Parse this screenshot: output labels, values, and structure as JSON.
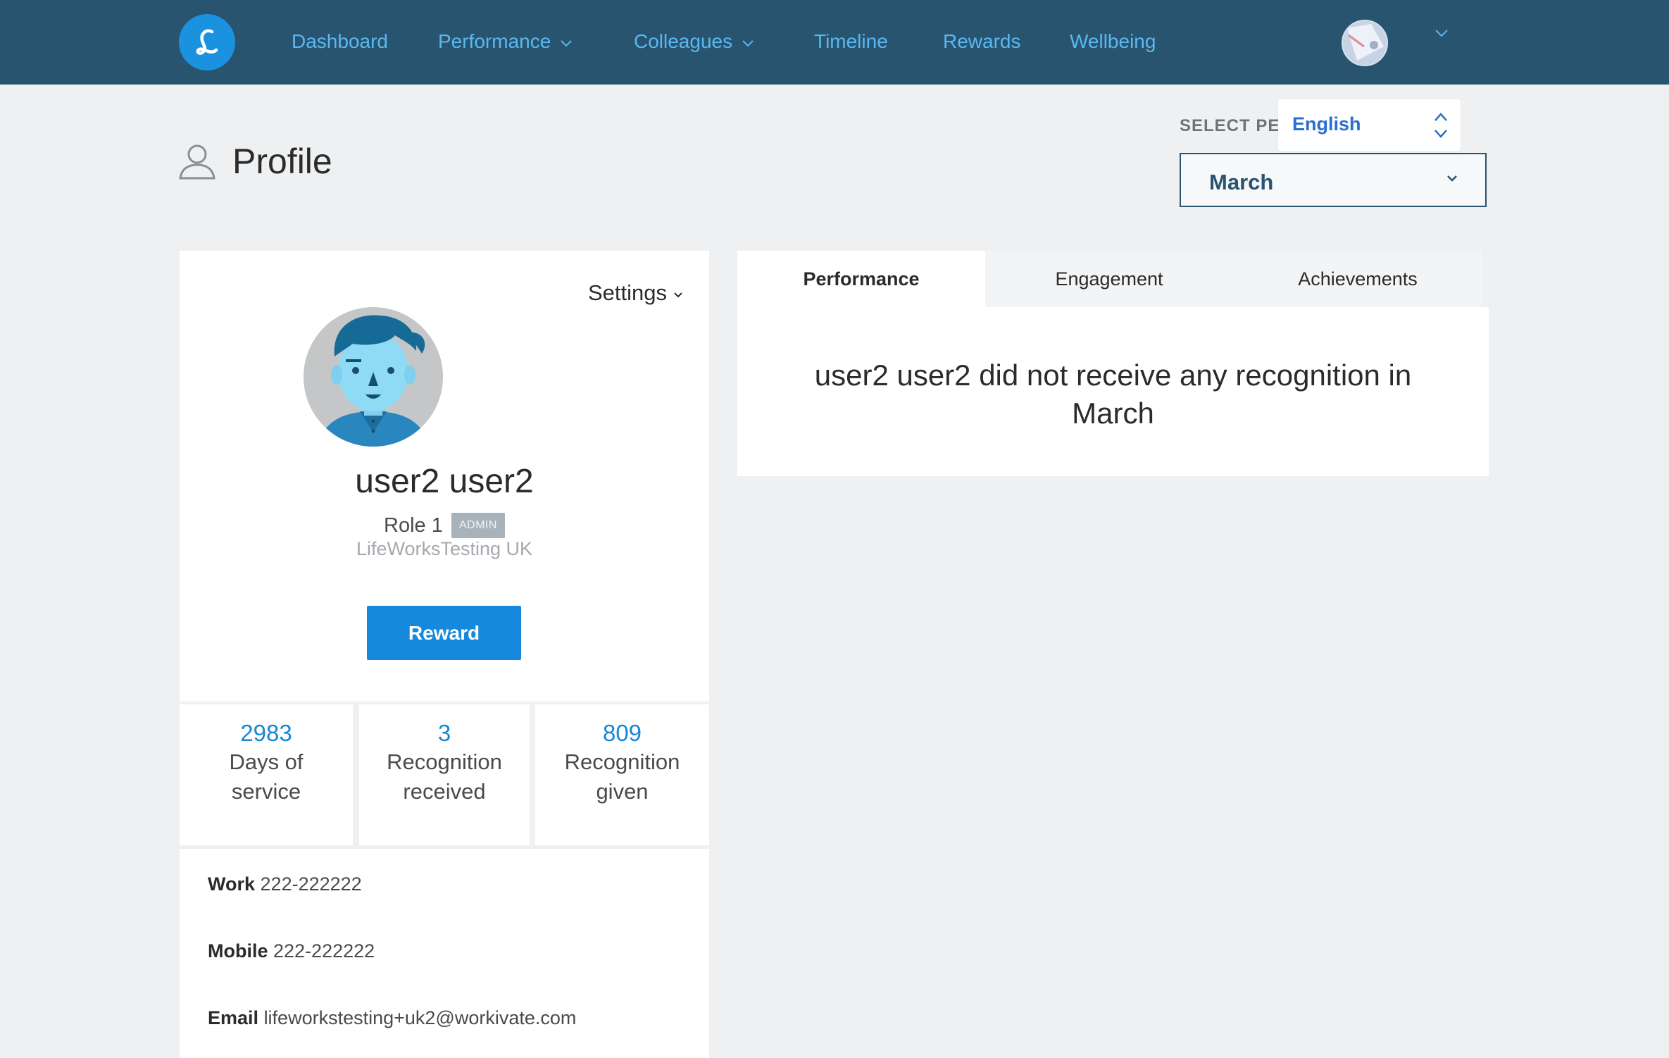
{
  "nav": {
    "items": [
      {
        "label": "Dashboard"
      },
      {
        "label": "Performance"
      },
      {
        "label": "Colleagues"
      },
      {
        "label": "Timeline"
      },
      {
        "label": "Rewards"
      },
      {
        "label": "Wellbeing"
      }
    ]
  },
  "header": {
    "title": "Profile",
    "period_label": "SELECT PERIOD",
    "language": "English",
    "period_value": "March"
  },
  "profile": {
    "settings_label": "Settings",
    "name": "user2 user2",
    "role": "Role 1",
    "badge": "ADMIN",
    "company": "LifeWorksTesting UK",
    "reward_label": "Reward"
  },
  "stats": [
    {
      "value": "2983",
      "label_line1": "Days of",
      "label_line2": "service"
    },
    {
      "value": "3",
      "label_line1": "Recognition",
      "label_line2": "received"
    },
    {
      "value": "809",
      "label_line1": "Recognition",
      "label_line2": "given"
    }
  ],
  "contact": {
    "work_label": "Work",
    "work_value": "222-222222",
    "mobile_label": "Mobile",
    "mobile_value": "222-222222",
    "email_label": "Email",
    "email_value": "lifeworkstesting+uk2@workivate.com"
  },
  "tabs": [
    {
      "label": "Performance"
    },
    {
      "label": "Engagement"
    },
    {
      "label": "Achievements"
    }
  ],
  "panel": {
    "message_line1": "user2 user2 did not receive any recognition in",
    "message_line2": "March"
  },
  "colors": {
    "nav_bg": "#28546f",
    "nav_text": "#5ab8f0",
    "accent": "#1689df",
    "stat_number": "#1787d4"
  }
}
